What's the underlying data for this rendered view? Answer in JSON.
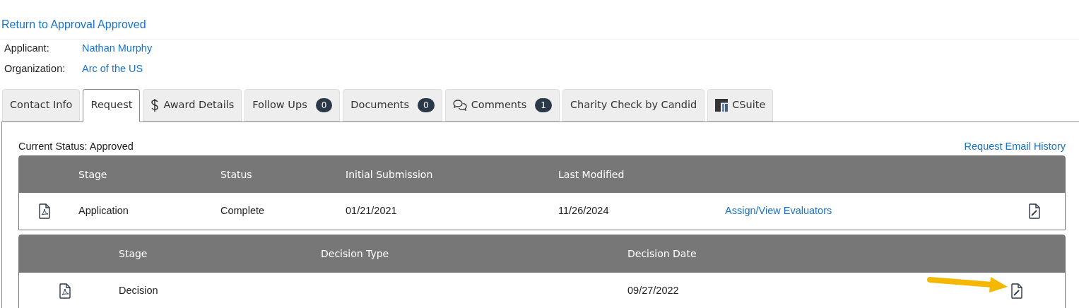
{
  "back_link": "Return to Approval Approved",
  "details": [
    {
      "label": "Applicant:",
      "value": "Nathan Murphy"
    },
    {
      "label": "Organization:",
      "value": "Arc of the US"
    }
  ],
  "tabs": [
    {
      "label": "Contact Info",
      "selected": false
    },
    {
      "label": "Request",
      "selected": true
    },
    {
      "label": "Award Details",
      "kind": "dollar",
      "selected": false
    },
    {
      "label": "Follow Ups",
      "badge": "0",
      "selected": false
    },
    {
      "label": "Documents",
      "badge": "0",
      "selected": false
    },
    {
      "label": "Comments",
      "kind": "comments",
      "badge": "1",
      "selected": false
    },
    {
      "label": "Charity Check by Candid",
      "selected": false
    },
    {
      "label": "CSuite",
      "kind": "logo",
      "selected": false
    }
  ],
  "current_status": "Current Status: Approved",
  "email_history_link": "Request Email History",
  "stages_table": {
    "columns": [
      "Stage",
      "Status",
      "Initial Submission",
      "Last Modified"
    ],
    "rows": [
      {
        "stage": "Application",
        "status": "Complete",
        "initial_submission": "01/21/2021",
        "last_modified": "11/26/2024",
        "link": "Assign/View Evaluators"
      }
    ]
  },
  "decision_table": {
    "columns": [
      "Stage",
      "Decision Type",
      "Decision Date"
    ],
    "rows": [
      {
        "stage": "Decision",
        "decision_date": "09/27/2022"
      }
    ]
  }
}
